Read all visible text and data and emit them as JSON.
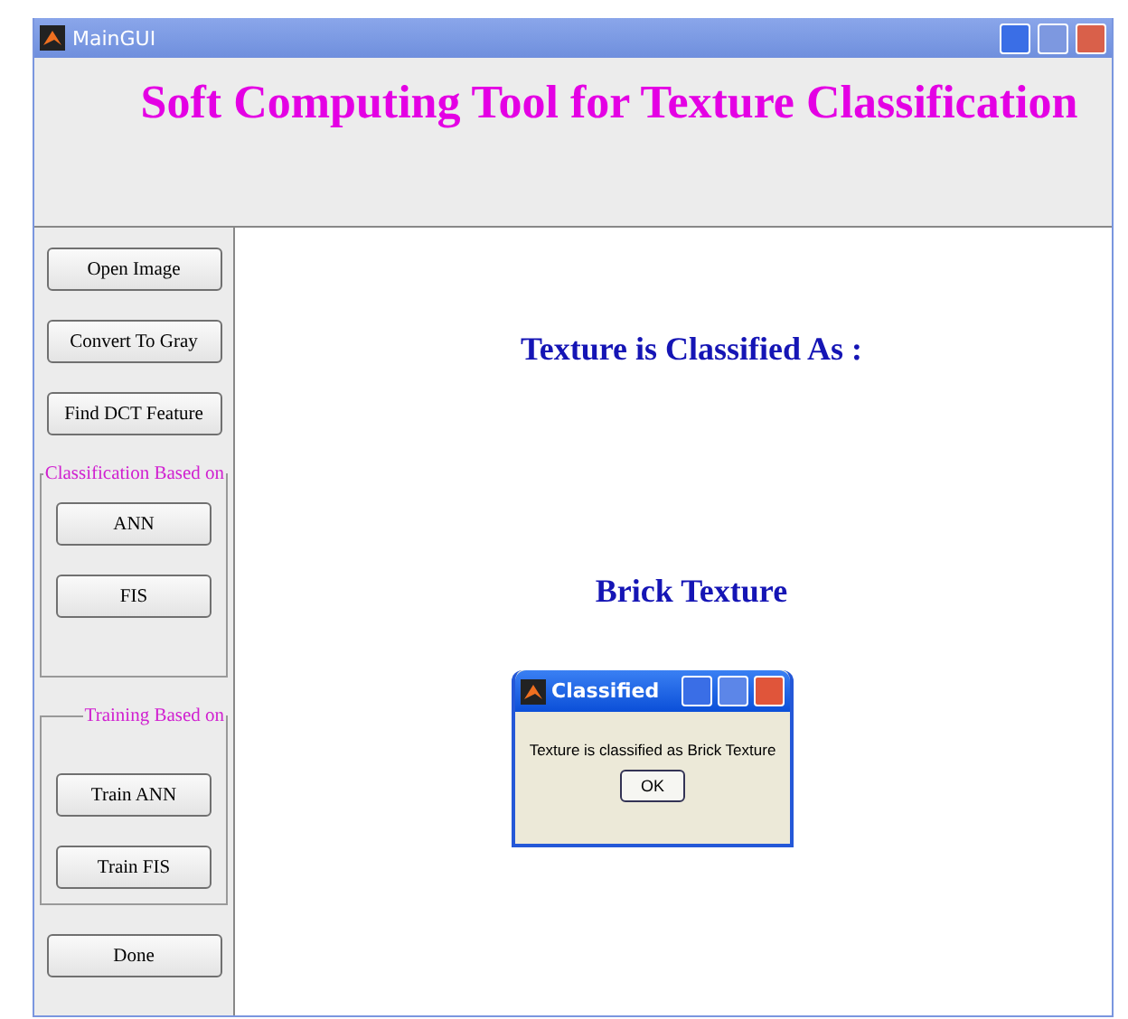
{
  "window": {
    "title": "MainGUI"
  },
  "header": {
    "title": "Soft Computing Tool for Texture Classification"
  },
  "sidebar": {
    "top_buttons": [
      "Open Image",
      "Convert To Gray",
      "Find DCT Feature"
    ],
    "groups": [
      {
        "title": "Classification Based on",
        "buttons": [
          "ANN",
          "FIS"
        ]
      },
      {
        "title": "Training Based on",
        "buttons": [
          "Train ANN",
          "Train FIS"
        ]
      }
    ],
    "bottom_buttons": [
      "Done"
    ]
  },
  "main": {
    "heading": "Texture is Classified As :",
    "result": "Brick Texture"
  },
  "dialog": {
    "title": "Classified",
    "message": "Texture is classified as Brick Texture",
    "button": "OK"
  }
}
